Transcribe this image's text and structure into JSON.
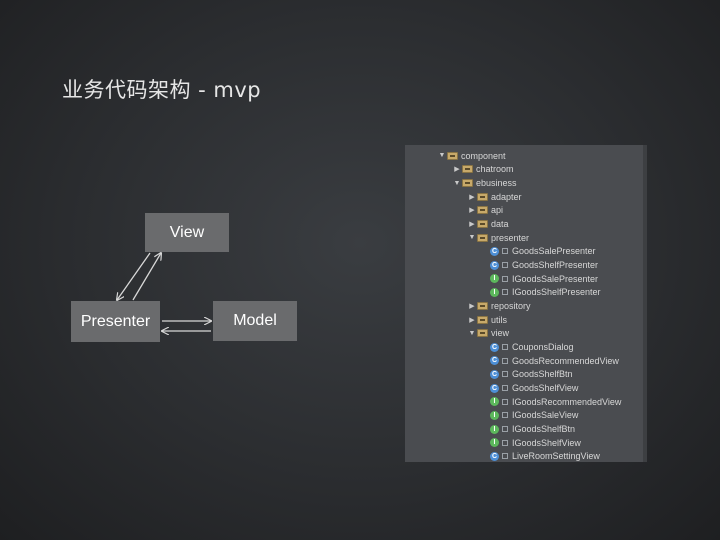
{
  "slide": {
    "title": "业务代码架构 - mvp"
  },
  "diagram": {
    "view_label": "View",
    "presenter_label": "Presenter",
    "model_label": "Model"
  },
  "tree": [
    {
      "label": "component",
      "kind": "folder",
      "depth": 0,
      "toggle": "expanded"
    },
    {
      "label": "chatroom",
      "kind": "folder",
      "depth": 1,
      "toggle": "collapsed"
    },
    {
      "label": "ebusiness",
      "kind": "folder",
      "depth": 1,
      "toggle": "expanded"
    },
    {
      "label": "adapter",
      "kind": "folder",
      "depth": 2,
      "toggle": "collapsed"
    },
    {
      "label": "api",
      "kind": "folder",
      "depth": 2,
      "toggle": "collapsed"
    },
    {
      "label": "data",
      "kind": "folder",
      "depth": 2,
      "toggle": "collapsed"
    },
    {
      "label": "presenter",
      "kind": "folder",
      "depth": 2,
      "toggle": "expanded"
    },
    {
      "label": "GoodsSalePresenter",
      "kind": "class",
      "depth": 3,
      "toggle": ""
    },
    {
      "label": "GoodsShelfPresenter",
      "kind": "class",
      "depth": 3,
      "toggle": ""
    },
    {
      "label": "IGoodsSalePresenter",
      "kind": "interface",
      "depth": 3,
      "toggle": ""
    },
    {
      "label": "IGoodsShelfPresenter",
      "kind": "interface",
      "depth": 3,
      "toggle": ""
    },
    {
      "label": "repository",
      "kind": "folder",
      "depth": 2,
      "toggle": "collapsed"
    },
    {
      "label": "utils",
      "kind": "folder",
      "depth": 2,
      "toggle": "collapsed"
    },
    {
      "label": "view",
      "kind": "folder",
      "depth": 2,
      "toggle": "expanded"
    },
    {
      "label": "CouponsDialog",
      "kind": "class",
      "depth": 3,
      "toggle": ""
    },
    {
      "label": "GoodsRecommendedView",
      "kind": "class",
      "depth": 3,
      "toggle": ""
    },
    {
      "label": "GoodsShelfBtn",
      "kind": "class",
      "depth": 3,
      "toggle": ""
    },
    {
      "label": "GoodsShelfView",
      "kind": "class",
      "depth": 3,
      "toggle": ""
    },
    {
      "label": "IGoodsRecommendedView",
      "kind": "interface",
      "depth": 3,
      "toggle": ""
    },
    {
      "label": "IGoodsSaleView",
      "kind": "interface",
      "depth": 3,
      "toggle": ""
    },
    {
      "label": "IGoodsShelfBtn",
      "kind": "interface",
      "depth": 3,
      "toggle": ""
    },
    {
      "label": "IGoodsShelfView",
      "kind": "interface",
      "depth": 3,
      "toggle": ""
    },
    {
      "label": "LiveRoomSettingView",
      "kind": "class",
      "depth": 3,
      "toggle": ""
    }
  ]
}
